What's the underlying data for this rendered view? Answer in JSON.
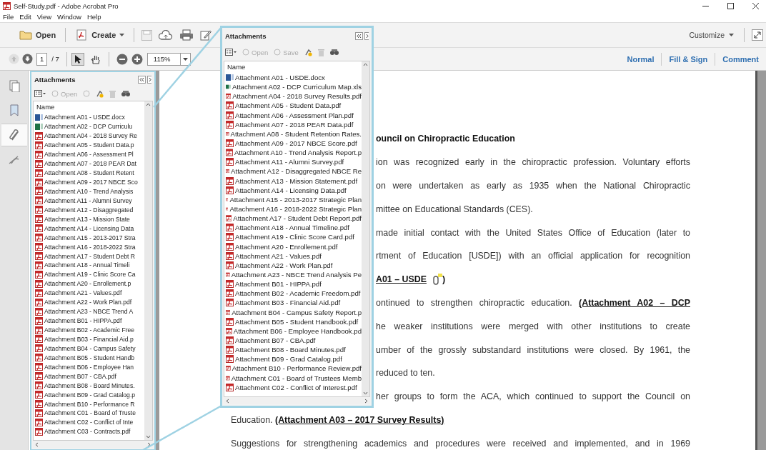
{
  "window": {
    "title": "Self-Study.pdf - Adobe Acrobat Pro"
  },
  "menu": [
    "File",
    "Edit",
    "View",
    "Window",
    "Help"
  ],
  "toolbar": {
    "open_label": "Open",
    "create_label": "Create",
    "customize_label": "Customize"
  },
  "navigation": {
    "prev_page": {
      "disabled": true
    },
    "next_page": {
      "disabled": false
    },
    "page_number": "1",
    "page_count": "/ 7",
    "select_tool": {
      "selected": true
    },
    "hand_tool": {
      "selected": false
    },
    "zoom": "115%",
    "modes": [
      "Normal",
      "Fill & Sign",
      "Comment"
    ]
  },
  "sidebar_strip": [
    {
      "selected": false
    },
    {
      "selected": false
    },
    {
      "selected": true
    },
    {
      "selected": false
    }
  ],
  "attachments_panel": {
    "title": "Attachments",
    "toolbar": {
      "open": {
        "label": "Open",
        "disabled": true
      },
      "save": {
        "disabled": true
      }
    },
    "column_header": "Name",
    "items": [
      {
        "name": "Attachment A01 - USDE.docx",
        "kind": "docx"
      },
      {
        "name": "Attachment A02 - DCP Curriculu",
        "kind": "xlsx"
      },
      {
        "name": "Attachment A04 - 2018 Survey Re",
        "kind": "pdf"
      },
      {
        "name": "Attachment A05 - Student Data.p",
        "kind": "pdf"
      },
      {
        "name": "Attachment A06 - Assessment Pl",
        "kind": "pdf"
      },
      {
        "name": "Attachment A07 - 2018 PEAR Dat",
        "kind": "pdf"
      },
      {
        "name": "Attachment A08 - Student Retent",
        "kind": "pdf"
      },
      {
        "name": "Attachment A09 - 2017 NBCE Sco",
        "kind": "pdf"
      },
      {
        "name": "Attachment A10 - Trend Analysis",
        "kind": "pdf"
      },
      {
        "name": "Attachment A11 - Alumni Survey",
        "kind": "pdf"
      },
      {
        "name": "Attachment A12 - Disaggregated",
        "kind": "pdf"
      },
      {
        "name": "Attachment A13 - Mission State",
        "kind": "pdf"
      },
      {
        "name": "Attachment A14 - Licensing Data",
        "kind": "pdf"
      },
      {
        "name": "Attachment A15 - 2013-2017 Stra",
        "kind": "pdf"
      },
      {
        "name": "Attachment A16 - 2018-2022 Stra",
        "kind": "pdf"
      },
      {
        "name": "Attachment A17 - Student Debt R",
        "kind": "pdf"
      },
      {
        "name": "Attachment A18 - Annual Timeli",
        "kind": "pdf"
      },
      {
        "name": "Attachment A19 - Clinic Score Ca",
        "kind": "pdf"
      },
      {
        "name": "Attachment A20 - Enrollement.p",
        "kind": "pdf"
      },
      {
        "name": "Attachment A21 - Values.pdf",
        "kind": "pdf"
      },
      {
        "name": "Attachment A22 - Work Plan.pdf",
        "kind": "pdf"
      },
      {
        "name": "Attachment A23 - NBCE Trend A",
        "kind": "pdf"
      },
      {
        "name": "Attachment B01 - HIPPA.pdf",
        "kind": "pdf"
      },
      {
        "name": "Attachment B02 - Academic Free",
        "kind": "pdf"
      },
      {
        "name": "Attachment B03 - Financial Aid.p",
        "kind": "pdf"
      },
      {
        "name": "Attachment B04 - Campus Safety",
        "kind": "pdf"
      },
      {
        "name": "Attachment B05 - Student Handb",
        "kind": "pdf"
      },
      {
        "name": "Attachment B06 - Employee Han",
        "kind": "pdf"
      },
      {
        "name": "Attachment B07 - CBA.pdf",
        "kind": "pdf"
      },
      {
        "name": "Attachment B08 - Board Minutes.",
        "kind": "pdf"
      },
      {
        "name": "Attachment B09 - Grad Catalog.p",
        "kind": "pdf"
      },
      {
        "name": "Attachment B10 - Performance R",
        "kind": "pdf"
      },
      {
        "name": "Attachment C01 - Board of Truste",
        "kind": "pdf"
      },
      {
        "name": "Attachment C02 - Conflict of Inte",
        "kind": "pdf"
      },
      {
        "name": "Attachment C03 - Contracts.pdf",
        "kind": "pdf"
      }
    ]
  },
  "zoomed_panel": {
    "title": "Attachments",
    "toolbar": {
      "open": {
        "label": "Open",
        "disabled": true
      },
      "save": {
        "label": "Save",
        "disabled": true
      }
    },
    "column_header": "Name",
    "items": [
      {
        "name": "Attachment A01 - USDE.docx",
        "kind": "docx"
      },
      {
        "name": "Attachment A02 - DCP Curriculum Map.xls",
        "kind": "xlsx"
      },
      {
        "name": "Attachment A04 - 2018 Survey Results.pdf",
        "kind": "pdf"
      },
      {
        "name": "Attachment A05 - Student Data.pdf",
        "kind": "pdf"
      },
      {
        "name": "Attachment A06 - Assessment Plan.pdf",
        "kind": "pdf"
      },
      {
        "name": "Attachment A07 - 2018 PEAR Data.pdf",
        "kind": "pdf"
      },
      {
        "name": "Attachment A08 - Student Retention Rates.",
        "kind": "pdf"
      },
      {
        "name": "Attachment A09 - 2017 NBCE Score.pdf",
        "kind": "pdf"
      },
      {
        "name": "Attachment A10 - Trend Analysis Report.p",
        "kind": "pdf"
      },
      {
        "name": "Attachment A11 - Alumni Survey.pdf",
        "kind": "pdf"
      },
      {
        "name": "Attachment A12 - Disaggregated NBCE Re",
        "kind": "pdf"
      },
      {
        "name": "Attachment A13 - Mission Statement.pdf",
        "kind": "pdf"
      },
      {
        "name": "Attachment A14 - Licensing Data.pdf",
        "kind": "pdf"
      },
      {
        "name": "Attachment A15 - 2013-2017 Strategic Plan",
        "kind": "pdf"
      },
      {
        "name": "Attachment A16 - 2018-2022 Strategic Plan",
        "kind": "pdf"
      },
      {
        "name": "Attachment A17 - Student Debt Report.pdf",
        "kind": "pdf"
      },
      {
        "name": "Attachment A18 - Annual Timeline.pdf",
        "kind": "pdf"
      },
      {
        "name": "Attachment A19 - Clinic Score Card.pdf",
        "kind": "pdf"
      },
      {
        "name": "Attachment A20 - Enrollement.pdf",
        "kind": "pdf"
      },
      {
        "name": "Attachment A21 - Values.pdf",
        "kind": "pdf"
      },
      {
        "name": "Attachment A22 - Work Plan.pdf",
        "kind": "pdf"
      },
      {
        "name": "Attachment A23 - NBCE Trend Analysis Pe",
        "kind": "pdf"
      },
      {
        "name": "Attachment B01 - HIPPA.pdf",
        "kind": "pdf"
      },
      {
        "name": "Attachment B02 - Academic Freedom.pdf",
        "kind": "pdf"
      },
      {
        "name": "Attachment B03 - Financial Aid.pdf",
        "kind": "pdf"
      },
      {
        "name": "Attachment B04 - Campus Safety Report.p",
        "kind": "pdf"
      },
      {
        "name": "Attachment B05 - Student Handbook.pdf",
        "kind": "pdf"
      },
      {
        "name": "Attachment B06 - Employee Handbook.pd",
        "kind": "pdf"
      },
      {
        "name": "Attachment B07 - CBA.pdf",
        "kind": "pdf"
      },
      {
        "name": "Attachment B08 - Board Minutes.pdf",
        "kind": "pdf"
      },
      {
        "name": "Attachment B09 - Grad Catalog.pdf",
        "kind": "pdf"
      },
      {
        "name": "Attachment B10 - Performance Review.pdf",
        "kind": "pdf"
      },
      {
        "name": "Attachment C01 - Board of Trustees Memb",
        "kind": "pdf"
      },
      {
        "name": "Attachment C02 - Conflict of Interest.pdf",
        "kind": "pdf"
      }
    ]
  },
  "document": {
    "lines_beside_zoom": [
      {
        "text": "ouncil on Chiropractic Education",
        "kind": "heading",
        "justified": false
      },
      {
        "text": "ion was recognized early in the chiropractic profession. Voluntary efforts",
        "kind": "body",
        "justified": true
      },
      {
        "text": "on were undertaken as early as 1935 when the National Chiropractic",
        "kind": "body",
        "justified": true
      },
      {
        "text": "mittee on Educational Standards (CES).",
        "kind": "body",
        "justified": false
      },
      {
        "text": "made initial contact with the United States Office of Education (later to",
        "kind": "body",
        "justified": true
      },
      {
        "text": "rtment of Education [USDE]) with an official application for recognition",
        "kind": "body",
        "justified": true
      },
      {
        "text": "**A01 – USDE**",
        "kind": "body",
        "justified": false,
        "attachment_icon": true,
        "trailing": ")"
      },
      {
        "text": "ontinued to strengthen chiropractic education. **(Attachment A02 – DCP**",
        "kind": "body",
        "justified": true
      },
      {
        "text": "he weaker institutions were merged with other institutions to create",
        "kind": "body",
        "justified": true
      },
      {
        "text": "umber of the grossly substandard institutions were closed. By 1961, the",
        "kind": "body",
        "justified": true
      },
      {
        "text": "reduced to ten.",
        "kind": "body",
        "justified": false
      },
      {
        "text": "her groups to form the ACA, which continued to support the Council on",
        "kind": "body",
        "justified": true
      }
    ],
    "lines_below_zoom": [
      {
        "text": "Education. **(Attachment A03 – 2017 Survey Results)**",
        "kind": "body",
        "justified": false
      },
      {
        "text": "Suggestions for strengthening academics and procedures were received and implemented, and in 1969",
        "kind": "body",
        "justified": true
      }
    ]
  }
}
